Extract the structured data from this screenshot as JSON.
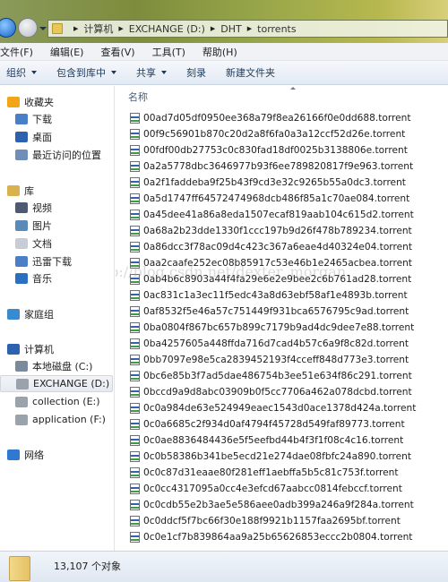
{
  "address": {
    "crumbs": [
      "计算机",
      "EXCHANGE (D:)",
      "DHT",
      "torrents"
    ]
  },
  "menu": [
    "文件(F)",
    "编辑(E)",
    "查看(V)",
    "工具(T)",
    "帮助(H)"
  ],
  "toolbar": [
    {
      "label": "组织",
      "dropdown": true
    },
    {
      "label": "包含到库中",
      "dropdown": true
    },
    {
      "label": "共享",
      "dropdown": true
    },
    {
      "label": "刻录",
      "dropdown": false
    },
    {
      "label": "新建文件夹",
      "dropdown": false
    }
  ],
  "sidebar": [
    {
      "label": "收藏夹",
      "icon": "star-icon",
      "level": 0,
      "color": "#f2a516"
    },
    {
      "label": "下载",
      "icon": "download-icon",
      "level": 1,
      "color": "#4a7fc8"
    },
    {
      "label": "桌面",
      "icon": "desktop-icon",
      "level": 1,
      "color": "#2d62b0"
    },
    {
      "label": "最近访问的位置",
      "icon": "recent-places-icon",
      "level": 1,
      "color": "#6f8fb8"
    },
    {
      "label": "库",
      "icon": "library-icon",
      "level": 0,
      "color": "#d9b24e"
    },
    {
      "label": "视频",
      "icon": "video-icon",
      "level": 1,
      "color": "#4d5a72"
    },
    {
      "label": "图片",
      "icon": "pictures-icon",
      "level": 1,
      "color": "#5a8ab8"
    },
    {
      "label": "文档",
      "icon": "documents-icon",
      "level": 1,
      "color": "#c8ccd4"
    },
    {
      "label": "迅雷下载",
      "icon": "thunder-download-icon",
      "level": 1,
      "color": "#4a7fc8"
    },
    {
      "label": "音乐",
      "icon": "music-icon",
      "level": 1,
      "color": "#2b6fc0"
    },
    {
      "label": "家庭组",
      "icon": "homegroup-icon",
      "level": 0,
      "color": "#3a8ad0"
    },
    {
      "label": "计算机",
      "icon": "computer-icon",
      "level": 0,
      "color": "#2d62b0"
    },
    {
      "label": "本地磁盘 (C:)",
      "icon": "windows-drive-icon",
      "level": 1,
      "color": "#7a8a9c"
    },
    {
      "label": "EXCHANGE (D:)",
      "icon": "drive-icon",
      "level": 1,
      "color": "#9aa2ac",
      "selected": true
    },
    {
      "label": "collection (E:)",
      "icon": "drive-icon",
      "level": 1,
      "color": "#9aa2ac"
    },
    {
      "label": "application (F:)",
      "icon": "drive-icon",
      "level": 1,
      "color": "#9aa2ac"
    },
    {
      "label": "网络",
      "icon": "network-icon",
      "level": 0,
      "color": "#2f7ad0"
    }
  ],
  "main": {
    "column_header": "名称",
    "files": [
      "00ad7d05df0950ee368a79f8ea26166f0e0dd688.torrent",
      "00f9c56901b870c20d2a8f6fa0a3a12ccf52d26e.torrent",
      "00fdf00db27753c0c830fad18df0025b3138806e.torrent",
      "0a2a5778dbc3646977b93f6ee789820817f9e963.torrent",
      "0a2f1faddeba9f25b43f9cd3e32c9265b55a0dc3.torrent",
      "0a5d1747ff64572474968dcb486f85a1c70ae084.torrent",
      "0a45dee41a86a8eda1507ecaf819aab104c615d2.torrent",
      "0a68a2b23dde1330f1ccc197b9d26f478b789234.torrent",
      "0a86dcc3f78ac09d4c423c367a6eae4d40324e04.torrent",
      "0aa2caafe252ec08b85917c53e46b1e2465acbea.torrent",
      "0ab4b6c8903a44f4fa29e6e2e9bee2c6b761ad28.torrent",
      "0ac831c1a3ec11f5edc43a8d63ebf58af1e4893b.torrent",
      "0af8532f5e46a57c751449f931bca6576795c9ad.torrent",
      "0ba0804f867bc657b899c7179b9ad4dc9dee7e88.torrent",
      "0ba4257605a448ffda716d7cad4b57c6a9f8c82d.torrent",
      "0bb7097e98e5ca2839452193f4cceff848d773e3.torrent",
      "0bc6e85b3f7ad5dae486754b3ee51e634f86c291.torrent",
      "0bccd9a9d8abc03909b0f5cc7706a462a078dcbd.torrent",
      "0c0a984de63e524949eaec1543d0ace1378d424a.torrent",
      "0c0a6685c2f934d0af4794f45728d549faf89773.torrent",
      "0c0ae8836484436e5f5eefbd44b4f3f1f08c4c16.torrent",
      "0c0b58386b341be5ecd21e274dae08fbfc24a890.torrent",
      "0c0c87d31eaae80f281eff1aebffa5b5c81c753f.torrent",
      "0c0cc4317095a0cc4e3efcd67aabcc0814febccf.torrent",
      "0c0cdb55e2b3ae5e586aee0adb399a246a9f284a.torrent",
      "0c0ddcf5f7bc66f30e188f9921b1157faa2695bf.torrent",
      "0c0e1cf7b839864aa9a25b65626853eccc2b0804.torrent"
    ]
  },
  "watermark": "http://blog.csdn.net/dexter_morgan",
  "status": {
    "count": "13,107 个对象"
  }
}
